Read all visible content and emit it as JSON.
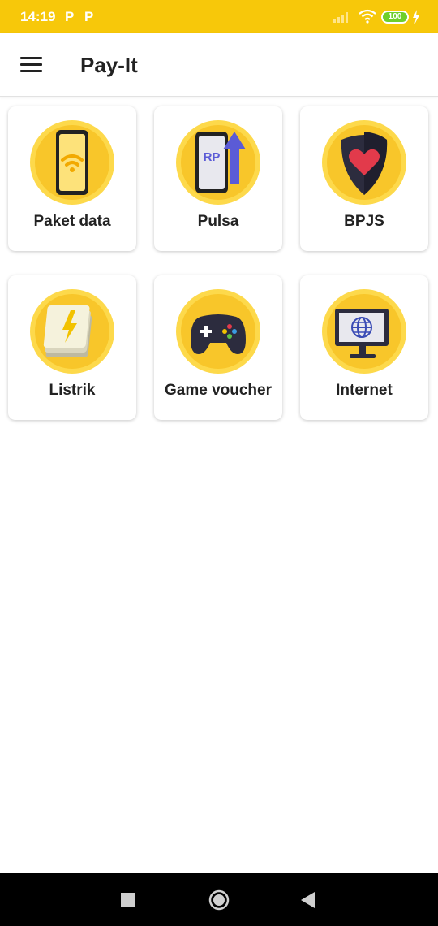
{
  "status_bar": {
    "time": "14:19",
    "notif_1": "P",
    "notif_2": "P",
    "battery": "100",
    "signal_icon": "signal-bars-icon",
    "wifi_icon": "wifi-icon",
    "charging_icon": "charging-bolt-icon"
  },
  "app_bar": {
    "title": "Pay-It",
    "menu_icon": "hamburger-menu-icon"
  },
  "services": [
    {
      "label": "Paket data",
      "icon": "phone-wifi-icon"
    },
    {
      "label": "Pulsa",
      "icon": "phone-rp-topup-icon",
      "icon_text": "RP"
    },
    {
      "label": "BPJS",
      "icon": "heart-shield-icon"
    },
    {
      "label": "Listrik",
      "icon": "electricity-token-icon"
    },
    {
      "label": "Game voucher",
      "icon": "gamepad-icon"
    },
    {
      "label": "Internet",
      "icon": "monitor-globe-icon"
    }
  ],
  "nav_bar": {
    "recents_icon": "square-recents-icon",
    "home_icon": "circle-home-icon",
    "back_icon": "triangle-back-icon"
  },
  "colors": {
    "status_bar": "#f7c80a",
    "icon_circle_outer": "#fdd94b",
    "icon_circle_inner": "#f8c62a",
    "battery_fill": "#6fcf2a"
  }
}
